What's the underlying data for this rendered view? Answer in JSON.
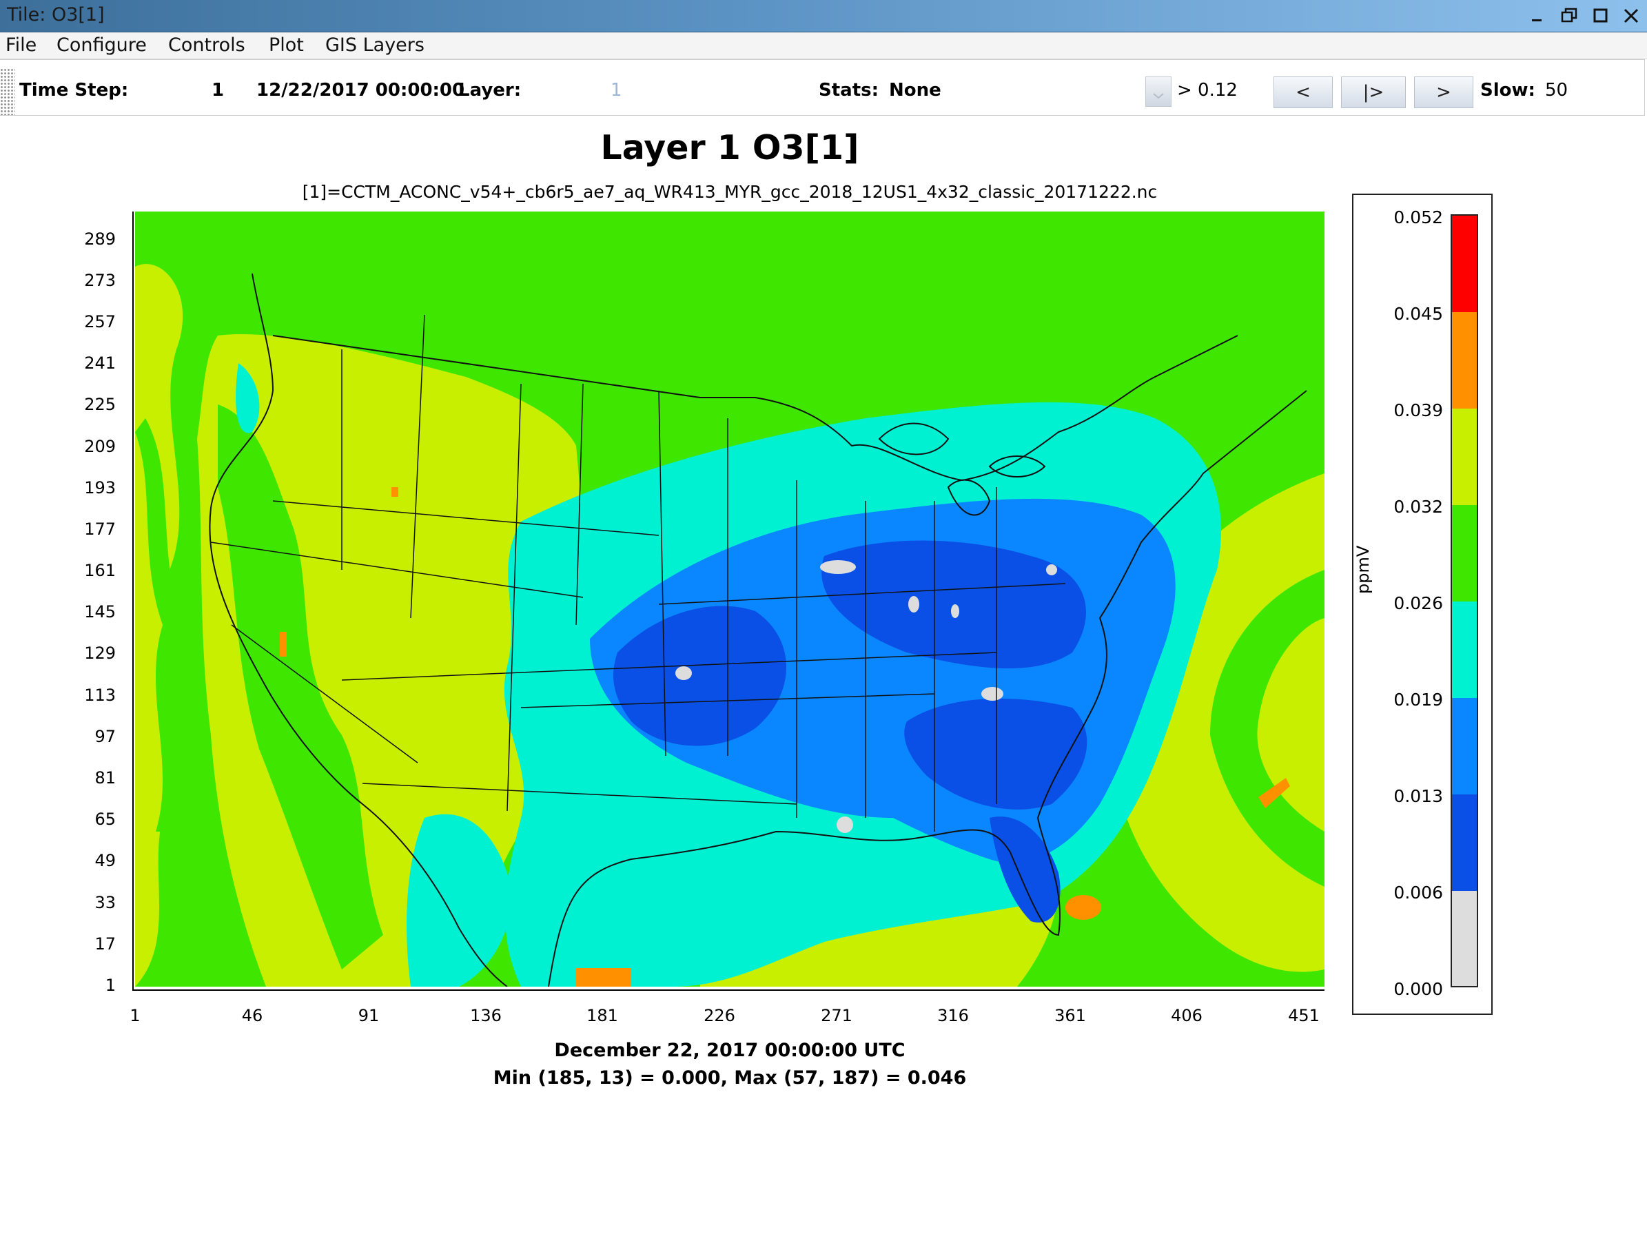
{
  "window": {
    "title": "Tile: O3[1]"
  },
  "menu": [
    "File",
    "Configure",
    "Controls",
    "Plot",
    "GIS Layers"
  ],
  "toolbar": {
    "time_step_label": "Time Step:",
    "time_step_value": "1",
    "datetime": "12/22/2017 00:00:00",
    "layer_label": "Layer:",
    "layer_value": "1",
    "stats_label": "Stats:",
    "stats_value": "None",
    "threshold": "> 0.12",
    "prev_label": "<",
    "play_label": "|>",
    "next_label": ">",
    "slow_label": "Slow:",
    "slow_value": "50"
  },
  "plot": {
    "title": "Layer 1 O3[1]",
    "subtitle": "[1]=CCTM_ACONC_v54+_cb6r5_ae7_aq_WR413_MYR_gcc_2018_12US1_4x32_classic_20171222.nc",
    "date_label": "December 22, 2017 00:00:00 UTC",
    "minmax_label": "Min (185, 13) = 0.000, Max (57, 187) = 0.046"
  },
  "chart_data": {
    "type": "heatmap",
    "title": "Layer 1 O3[1]",
    "subtitle": "[1]=CCTM_ACONC_v54+_cb6r5_ae7_aq_WR413_MYR_gcc_2018_12US1_4x32_classic_20171222.nc",
    "x_ticks": [
      "1",
      "46",
      "91",
      "136",
      "181",
      "226",
      "271",
      "316",
      "361",
      "406",
      "451"
    ],
    "y_ticks": [
      "289",
      "273",
      "257",
      "241",
      "225",
      "209",
      "193",
      "177",
      "161",
      "145",
      "129",
      "113",
      "97",
      "81",
      "65",
      "49",
      "33",
      "17",
      "1"
    ],
    "xlim": [
      1,
      459
    ],
    "ylim": [
      1,
      299
    ],
    "min": {
      "col": 185,
      "row": 13,
      "value": 0.0
    },
    "max": {
      "col": 57,
      "row": 187,
      "value": 0.046
    },
    "colorbar": {
      "unit": "ppmV",
      "labels": [
        "0.052",
        "0.045",
        "0.039",
        "0.032",
        "0.026",
        "0.019",
        "0.013",
        "0.006",
        "0.000"
      ],
      "colors": [
        "#ff0000",
        "#ff9100",
        "#c8ef00",
        "#3ee600",
        "#00f0d2",
        "#0a86ff",
        "#0a50e6",
        "#dddddd"
      ]
    }
  },
  "colors": {
    "ocean_green": "#3ee600",
    "land_yellow": "#c8ef00",
    "cyan": "#00f0d2",
    "light_blue": "#0a86ff",
    "blue": "#0a50e6",
    "orange": "#ff9100",
    "gray": "#dddddd"
  }
}
